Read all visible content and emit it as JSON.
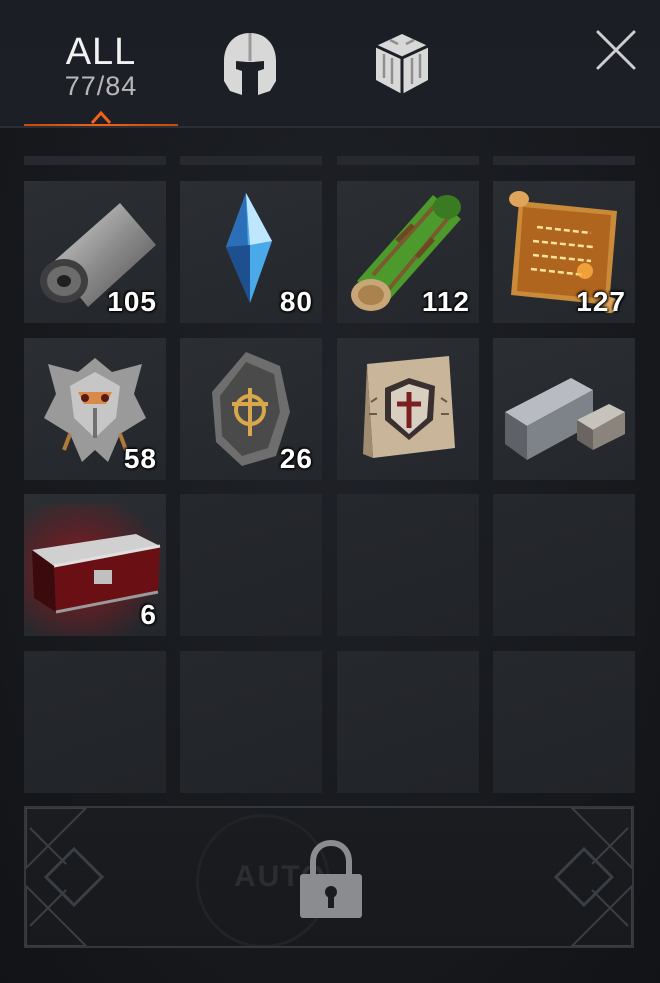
{
  "tabs": {
    "all": {
      "label": "ALL",
      "count": "77/84",
      "active": true
    },
    "equipment": {
      "icon": "helmet-icon"
    },
    "materials": {
      "icon": "crate-icon"
    }
  },
  "close": {
    "icon": "close-icon"
  },
  "inventory": {
    "slots": [
      {
        "item": "cloth-roll",
        "qty": "105"
      },
      {
        "item": "blue-crystal",
        "qty": "80"
      },
      {
        "item": "mossy-log",
        "qty": "112"
      },
      {
        "item": "glowing-scroll",
        "qty": "127"
      },
      {
        "item": "dragon-crest",
        "qty": "58"
      },
      {
        "item": "rune-stone",
        "qty": "26"
      },
      {
        "item": "shield-scroll",
        "qty": ""
      },
      {
        "item": "iron-ingots",
        "qty": ""
      },
      {
        "item": "red-chest",
        "qty": "6"
      },
      {
        "item": "",
        "qty": ""
      },
      {
        "item": "",
        "qty": ""
      },
      {
        "item": "",
        "qty": ""
      },
      {
        "item": "",
        "qty": ""
      },
      {
        "item": "",
        "qty": ""
      },
      {
        "item": "",
        "qty": ""
      },
      {
        "item": "",
        "qty": ""
      }
    ]
  },
  "auto_panel": {
    "watermark": "AUTO",
    "lock_icon": "padlock-icon"
  },
  "colors": {
    "accent": "#f0621a",
    "slot_bg": "#2b2e33",
    "panel_bg": "#16181c"
  }
}
